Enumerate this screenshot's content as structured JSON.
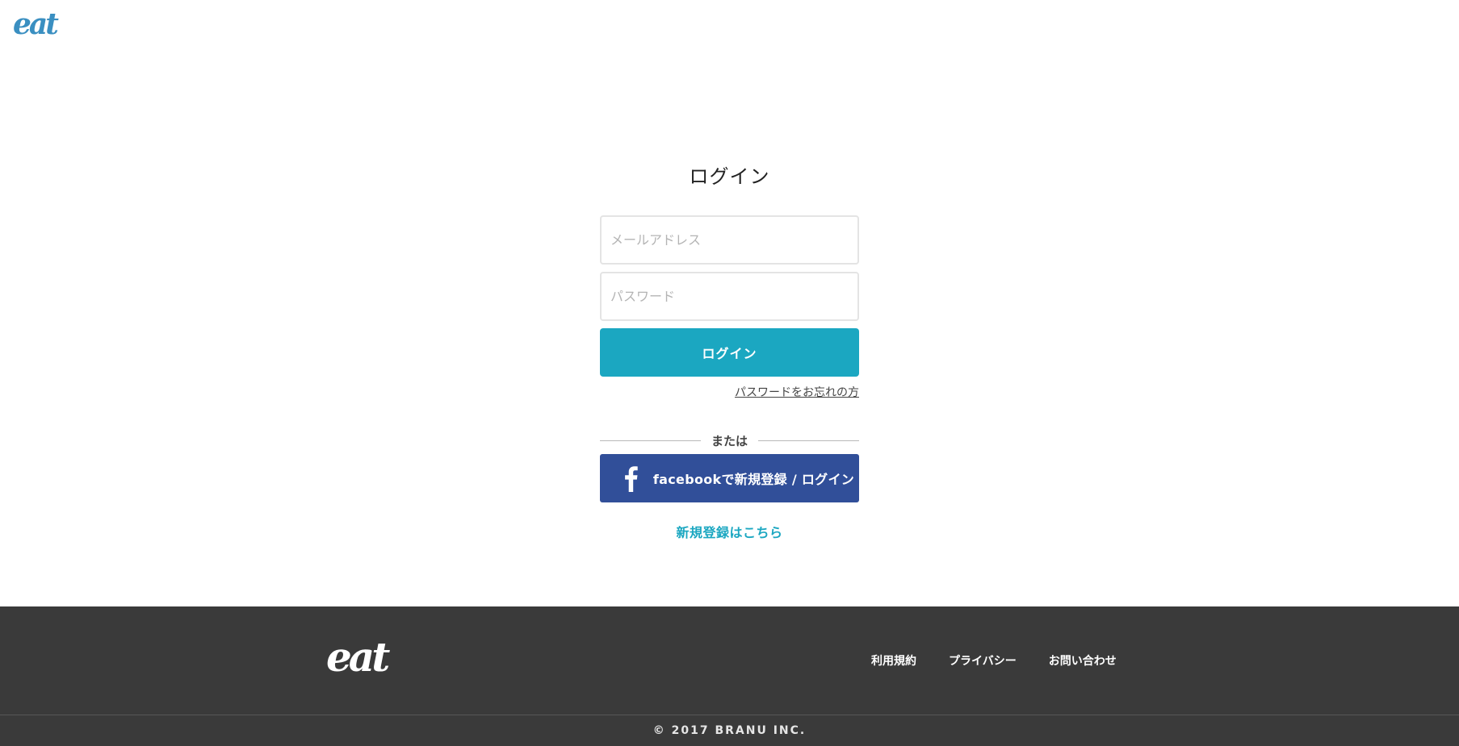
{
  "header": {
    "logo_text": "eat",
    "brand_color": "#3a8fc1"
  },
  "login": {
    "title": "ログイン",
    "email_placeholder": "メールアドレス",
    "password_placeholder": "パスワード",
    "submit_label": "ログイン",
    "forgot_password": "パスワードをお忘れの方",
    "divider_text": "または",
    "facebook_label": "facebookで新規登録 / ログイン",
    "signup_link": "新規登録はこちら",
    "accent_color": "#1ba7c1",
    "facebook_color": "#314f99"
  },
  "footer": {
    "logo_text": "eat",
    "links": [
      "利用規約",
      "プライバシー",
      "お問い合わせ"
    ],
    "copyright": "© 2017 BRANU INC.",
    "background_color": "#3a3a3a"
  },
  "icons": {
    "facebook": "facebook-f-icon"
  }
}
